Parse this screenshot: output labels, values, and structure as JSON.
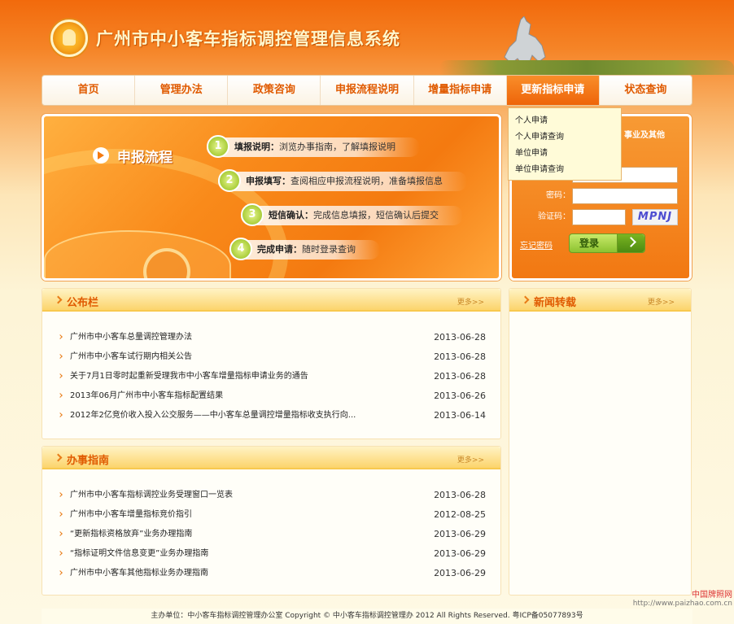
{
  "header": {
    "site_title": "广州市中小客车指标调控管理信息系统"
  },
  "nav": {
    "items": [
      {
        "label": "首页"
      },
      {
        "label": "管理办法"
      },
      {
        "label": "政策咨询"
      },
      {
        "label": "申报流程说明"
      },
      {
        "label": "增量指标申请"
      },
      {
        "label": "更新指标申请"
      },
      {
        "label": "状态查询"
      }
    ],
    "active_index": 5
  },
  "dropdown": {
    "items": [
      "个人申请",
      "个人申请查询",
      "单位申请",
      "单位申请查询"
    ]
  },
  "banner": {
    "title": "申报流程",
    "steps": [
      {
        "num": "1",
        "label": "填报说明：",
        "text": "浏览办事指南，了解填报说明"
      },
      {
        "num": "2",
        "label": "申报填写：",
        "text": "查阅相应申报流程说明，准备填报信息"
      },
      {
        "num": "3",
        "label": "短信确认：",
        "text": "完成信息填报，短信确认后提交"
      },
      {
        "num": "4",
        "label": "完成申请：",
        "text": "随时登录查询"
      }
    ]
  },
  "login": {
    "tab_label": "事业及其他",
    "password_label": "密码：",
    "captcha_label": "验证码：",
    "captcha_text": "MPNJ",
    "forgot_label": "忘记密码",
    "login_button": "登录"
  },
  "announcements": {
    "title": "公布栏",
    "more": "更多>>",
    "items": [
      {
        "title": "广州市中小客车总量调控管理办法",
        "date": "2013-06-28"
      },
      {
        "title": "广州市中小客车试行期内相关公告",
        "date": "2013-06-28"
      },
      {
        "title": "关于7月1日零时起重新受理我市中小客车增量指标申请业务的通告",
        "date": "2013-06-28"
      },
      {
        "title": "2013年06月广州市中小客车指标配置结果",
        "date": "2013-06-26"
      },
      {
        "title": "2012年2亿竞价收入投入公交服务——中小客车总量调控增量指标收支执行向...",
        "date": "2013-06-14"
      }
    ]
  },
  "news": {
    "title": "新闻转载",
    "more": "更多>>"
  },
  "guide": {
    "title": "办事指南",
    "more": "更多>>",
    "items": [
      {
        "title": "广州市中小客车指标调控业务受理窗口一览表",
        "date": "2013-06-28"
      },
      {
        "title": "广州市中小客车增量指标竞价指引",
        "date": "2012-08-25"
      },
      {
        "title": "“更新指标资格放弃”业务办理指南",
        "date": "2013-06-29"
      },
      {
        "title": "“指标证明文件信息变更”业务办理指南",
        "date": "2013-06-29"
      },
      {
        "title": "广州市中小客车其他指标业务办理指南",
        "date": "2013-06-29"
      }
    ]
  },
  "footer": {
    "text": "主办单位：中小客车指标调控管理办公室  Copyright ©  中小客车指标调控管理办   2012  All Rights Reserved.  粤ICP备05077893号"
  },
  "watermark": {
    "name": "中国牌照网",
    "url": "http://www.paizhao.com.cn"
  }
}
